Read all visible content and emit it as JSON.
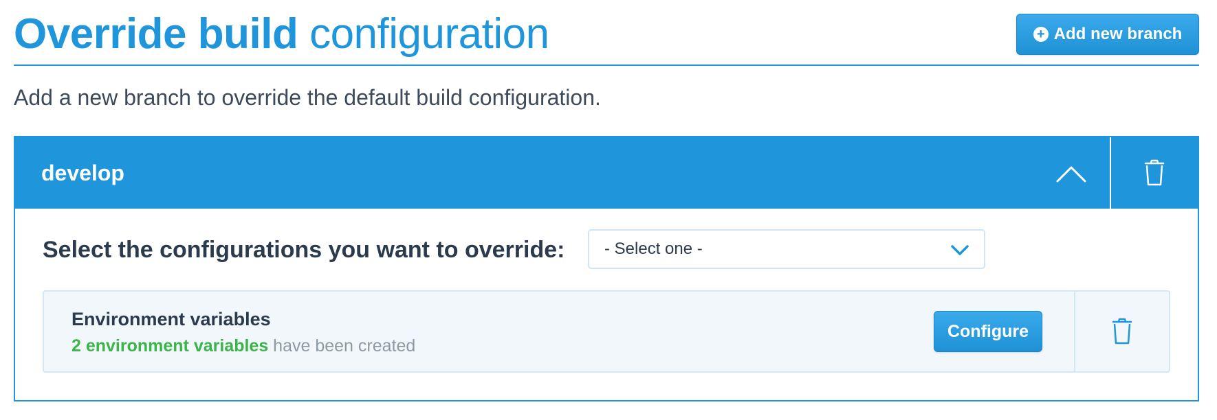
{
  "header": {
    "title_bold": "Override build",
    "title_light": "configuration",
    "add_branch_label": "Add new branch",
    "add_branch_icon": "plus-circle-icon"
  },
  "subtitle": "Add a new branch to override the default build configuration.",
  "branch": {
    "name": "develop",
    "collapse_icon": "chevron-up-icon",
    "delete_icon": "trash-icon",
    "select_label": "Select the configurations you want to override:",
    "select": {
      "value": "- Select one -",
      "icon": "chevron-down-icon"
    },
    "configs": [
      {
        "title": "Environment variables",
        "count_text": "2 environment variables",
        "suffix_text": " have been created",
        "configure_label": "Configure",
        "delete_icon": "trash-icon"
      }
    ]
  },
  "colors": {
    "accent": "#1f96dc",
    "text_dark": "#2b3a4d",
    "success": "#3cb44a",
    "muted": "#8e99a6",
    "row_bg": "#f2f7fb"
  }
}
